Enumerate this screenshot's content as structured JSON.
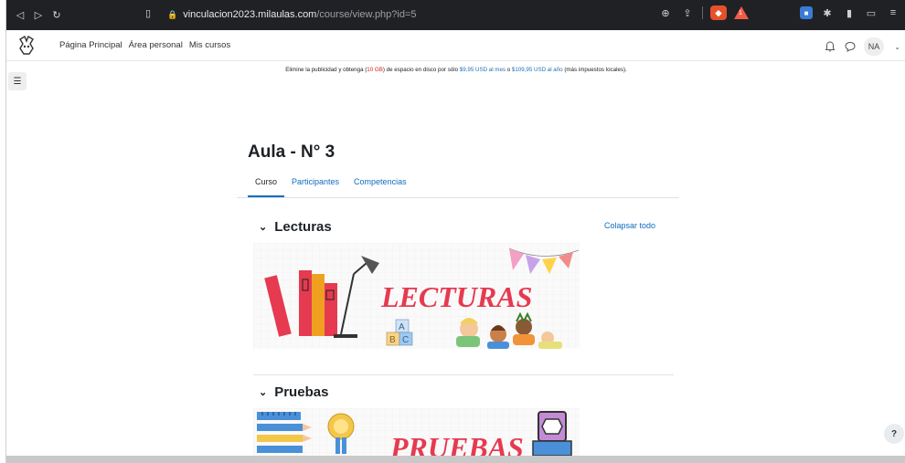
{
  "browser": {
    "url_domain": "vinculacion2023.milaulas.com",
    "url_path": "/course/view.php?id=5",
    "nav_icons": [
      "back-icon",
      "forward-icon",
      "reload-icon"
    ],
    "brave_badge": "",
    "rewards_badge": "1"
  },
  "topnav": {
    "links": [
      "Página Principal",
      "Área personal",
      "Mis cursos"
    ],
    "avatar_initials": "NA"
  },
  "ad": {
    "part1": "Elimine la publicidad y obtenga (",
    "highlight": "10 GB",
    "part2": ") de espacio en disco por sólo ",
    "price_month": "$9,95 USD al mes",
    "part3": " o ",
    "price_year": "$109,95 USD al año",
    "part4": " (más impuestos locales)."
  },
  "course": {
    "title": "Aula - N° 3",
    "tabs": [
      "Curso",
      "Participantes",
      "Competencias"
    ],
    "active_tab": "Curso",
    "collapse_all": "Colapsar todo",
    "sections": [
      {
        "title": "Lecturas",
        "banner_text": "LECTURAS",
        "blocks": [
          "A",
          "B",
          "C"
        ]
      },
      {
        "title": "Pruebas",
        "banner_text": "PRUEBAS"
      }
    ]
  },
  "help_label": "?",
  "colors": {
    "accent": "#0f6cbf",
    "banner_red": "#e63a50",
    "chrome_bg": "#202124"
  }
}
